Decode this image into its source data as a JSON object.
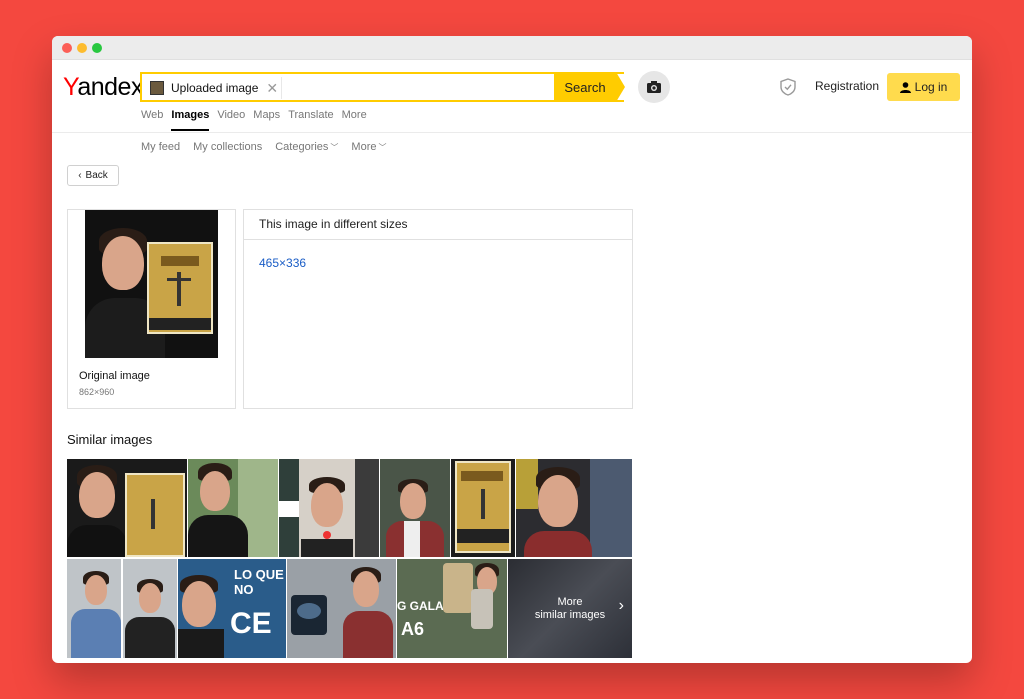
{
  "brand": {
    "logo_first": "Y",
    "logo_rest": "andex"
  },
  "search": {
    "chip_label": "Uploaded image",
    "button_label": "Search"
  },
  "header": {
    "registration": "Registration",
    "login": "Log in"
  },
  "tabs": [
    {
      "label": "Web",
      "active": false
    },
    {
      "label": "Images",
      "active": true
    },
    {
      "label": "Video",
      "active": false
    },
    {
      "label": "Maps",
      "active": false
    },
    {
      "label": "Translate",
      "active": false
    },
    {
      "label": "More",
      "active": false
    }
  ],
  "subnav": {
    "my_feed": "My feed",
    "my_collections": "My collections",
    "categories": "Categories",
    "more": "More"
  },
  "back_label": "Back",
  "original": {
    "caption": "Original image",
    "dims": "862×960"
  },
  "sizes": {
    "heading": "This image in different sizes",
    "link": "465×336"
  },
  "similar": {
    "title": "Similar images",
    "more_line1": "More",
    "more_line2": "similar images"
  },
  "colors": {
    "accent": "#ffcc00",
    "login_bg": "#ffdb4d",
    "link": "#1a5dc6",
    "background": "#f4483f"
  }
}
